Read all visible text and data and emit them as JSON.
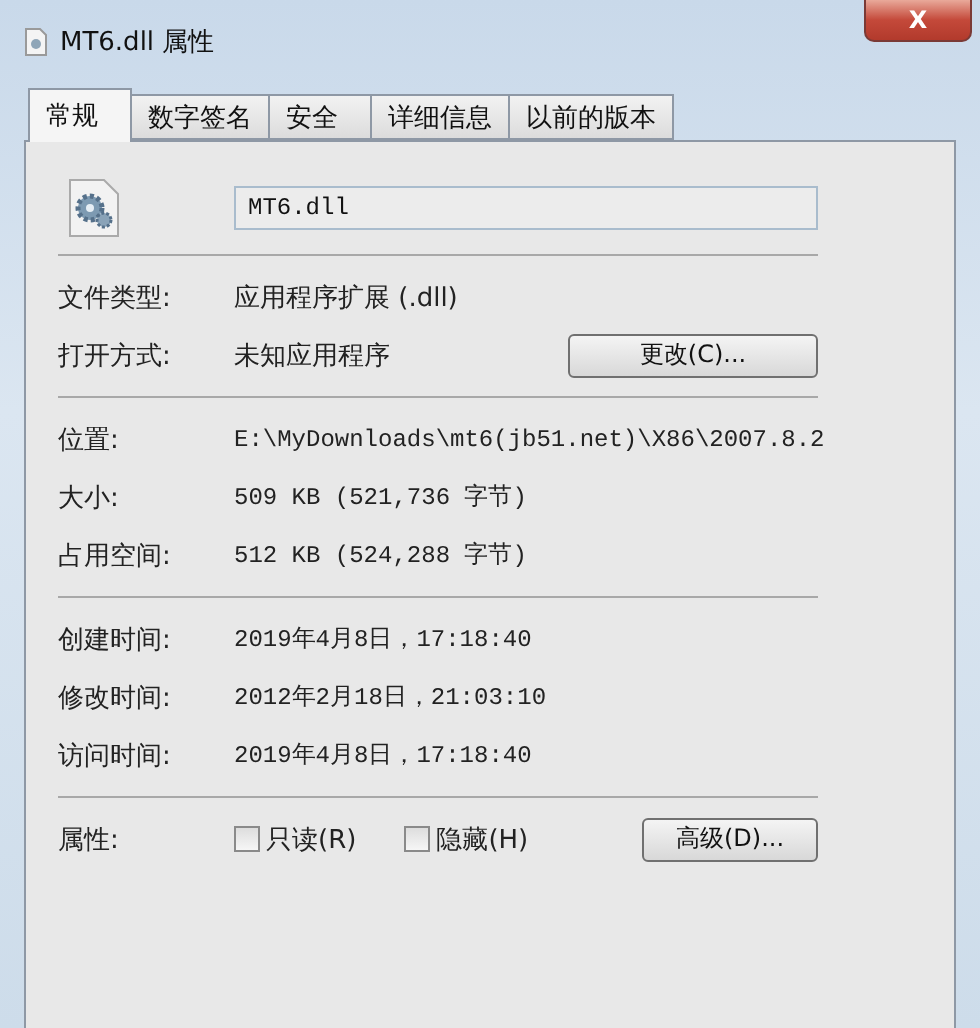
{
  "window": {
    "title": "MT6.dll 属性",
    "close": "X"
  },
  "tabs": [
    {
      "label": "常规",
      "selected": true
    },
    {
      "label": "数字签名",
      "selected": false
    },
    {
      "label": "安全",
      "selected": false
    },
    {
      "label": "详细信息",
      "selected": false
    },
    {
      "label": "以前的版本",
      "selected": false
    }
  ],
  "file_name": "MT6.dll",
  "type_rows": [
    {
      "label": "文件类型:",
      "value": "应用程序扩展 (.dll)"
    },
    {
      "label": "打开方式:",
      "value": "未知应用程序",
      "button": "更改(C)..."
    }
  ],
  "location_rows": [
    {
      "label": "位置:",
      "value": "E:\\MyDownloads\\mt6(jb51.net)\\X86\\2007.8.2"
    },
    {
      "label": "大小:",
      "value": "509 KB (521,736 字节)"
    },
    {
      "label": "占用空间:",
      "value": "512 KB (524,288 字节)"
    }
  ],
  "time_rows": [
    {
      "label": "创建时间:",
      "value": "2019年4月8日，17:18:40"
    },
    {
      "label": "修改时间:",
      "value": "2012年2月18日，21:03:10"
    },
    {
      "label": "访问时间:",
      "value": "2019年4月8日，17:18:40"
    }
  ],
  "attributes": {
    "label": "属性:",
    "checkboxes": [
      {
        "label": "只读(R)",
        "checked": false
      },
      {
        "label": "隐藏(H)",
        "checked": false
      }
    ],
    "button": "高级(D)..."
  }
}
